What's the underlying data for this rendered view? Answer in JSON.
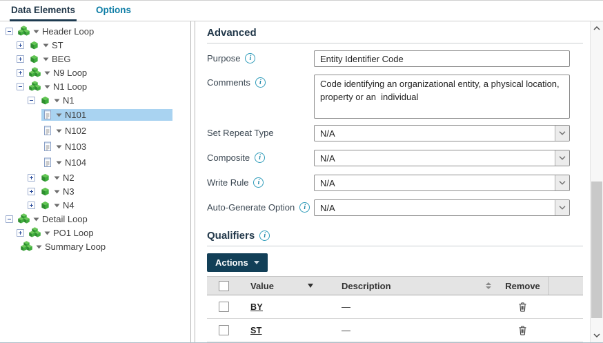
{
  "tabs": [
    {
      "label": "Data Elements",
      "active": true
    },
    {
      "label": "Options",
      "active": false
    }
  ],
  "tree": {
    "items": [
      {
        "label": "Header Loop",
        "icon": "loop-icon",
        "expander": "minus",
        "indent": 0,
        "selected": false
      },
      {
        "label": "ST",
        "icon": "segment-icon",
        "expander": "plus",
        "indent": 1,
        "selected": false
      },
      {
        "label": "BEG",
        "icon": "segment-icon",
        "expander": "plus",
        "indent": 1,
        "selected": false
      },
      {
        "label": "N9 Loop",
        "icon": "loop-icon",
        "expander": "plus",
        "indent": 1,
        "selected": false
      },
      {
        "label": "N1 Loop",
        "icon": "loop-icon",
        "expander": "minus",
        "indent": 1,
        "selected": false
      },
      {
        "label": "N1",
        "icon": "segment-icon",
        "expander": "minus",
        "indent": 2,
        "selected": false
      },
      {
        "label": "N101",
        "icon": "element-icon",
        "expander": "none",
        "indent": 3,
        "selected": true
      },
      {
        "label": "N102",
        "icon": "element-icon",
        "expander": "none",
        "indent": 3,
        "selected": false
      },
      {
        "label": "N103",
        "icon": "element-icon",
        "expander": "none",
        "indent": 3,
        "selected": false
      },
      {
        "label": "N104",
        "icon": "element-icon",
        "expander": "none",
        "indent": 3,
        "selected": false
      },
      {
        "label": "N2",
        "icon": "segment-icon",
        "expander": "plus",
        "indent": 2,
        "selected": false
      },
      {
        "label": "N3",
        "icon": "segment-icon",
        "expander": "plus",
        "indent": 2,
        "selected": false
      },
      {
        "label": "N4",
        "icon": "segment-icon",
        "expander": "plus",
        "indent": 2,
        "selected": false
      },
      {
        "label": "Detail Loop",
        "icon": "loop-icon",
        "expander": "minus",
        "indent": 0,
        "selected": false
      },
      {
        "label": "PO1 Loop",
        "icon": "loop-icon",
        "expander": "plus",
        "indent": 1,
        "selected": false
      },
      {
        "label": "Summary Loop",
        "icon": "loop-icon",
        "expander": "none",
        "indent": 1,
        "selected": false
      }
    ]
  },
  "panel": {
    "advanced_title": "Advanced",
    "fields": [
      {
        "label": "Purpose",
        "info": true,
        "type": "input",
        "value": "Entity Identifier Code"
      },
      {
        "label": "Comments",
        "info": true,
        "type": "textarea",
        "value": "Code identifying an organizational entity, a physical location, property or an  individual"
      },
      {
        "label": "Set Repeat Type",
        "info": false,
        "type": "select",
        "value": "N/A"
      },
      {
        "label": "Composite",
        "info": true,
        "type": "select",
        "value": "N/A"
      },
      {
        "label": "Write Rule",
        "info": true,
        "type": "select",
        "value": "N/A"
      },
      {
        "label": "Auto-Generate Option",
        "info": true,
        "type": "select",
        "value": "N/A"
      }
    ],
    "qualifiers": {
      "title": "Qualifiers",
      "actions_label": "Actions",
      "columns": {
        "value": "Value",
        "description": "Description",
        "remove": "Remove"
      },
      "rows": [
        {
          "value": "BY",
          "description": "—"
        },
        {
          "value": "ST",
          "description": "—"
        }
      ]
    }
  },
  "icons": {
    "tree_loop": "loop-icon",
    "tree_segment": "segment-icon",
    "tree_element": "element-icon",
    "info": "info-icon",
    "trash": "trash-icon",
    "sort_descending": "sort-desc-icon",
    "sort_unsorted": "sort-both-icon",
    "caret": "caret-down-icon"
  },
  "colors": {
    "accent": "#0f7ea6",
    "heading": "#22384a",
    "actions_button": "#123f57",
    "selection": "#a9d3f1",
    "tree_green": "#3fae3d",
    "link": "#222222"
  }
}
